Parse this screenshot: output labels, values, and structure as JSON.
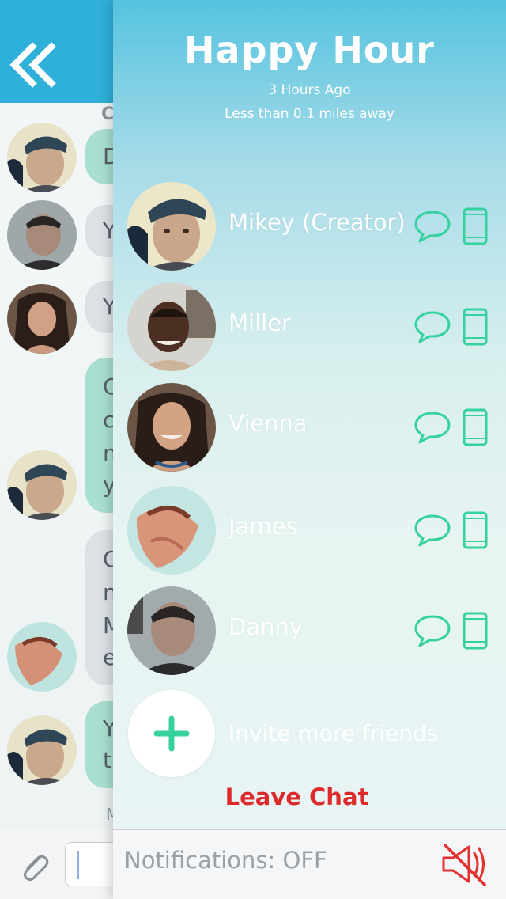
{
  "chat": {
    "header_color": "#2fb0d8",
    "peek_letters": {
      "top": "C",
      "bottom": "M"
    },
    "message_fragments": [
      {
        "text": "D"
      },
      {
        "text": "Y"
      },
      {
        "text": "Y"
      },
      {
        "lines": [
          "C",
          "c",
          "n",
          "y"
        ]
      },
      {
        "lines": [
          "C",
          "n",
          "M",
          "e"
        ]
      },
      {
        "lines": [
          "Y",
          "t"
        ]
      }
    ]
  },
  "panel": {
    "title": "Happy Hour",
    "time_ago": "3 Hours Ago",
    "distance": "Less than 0.1 miles away",
    "members": [
      {
        "name": "Mikey (Creator)"
      },
      {
        "name": "Miller"
      },
      {
        "name": "Vienna"
      },
      {
        "name": "James"
      },
      {
        "name": "Danny"
      }
    ],
    "invite_label": "Invite more friends",
    "leave_label": "Leave Chat",
    "notifications_label": "Notifications: OFF"
  },
  "colors": {
    "accent_green": "#35d19e",
    "leave_red": "#dd2b2b",
    "mute_red": "#e53030"
  }
}
